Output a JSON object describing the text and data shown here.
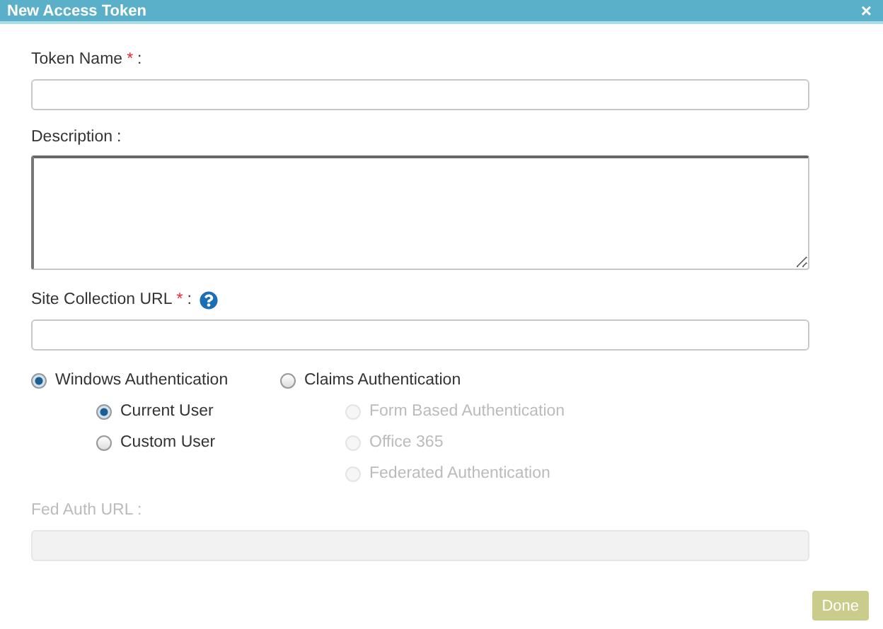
{
  "dialog": {
    "title": "New Access Token",
    "close": "×"
  },
  "fields": [
    {
      "label": "Token Name",
      "required_mark": "*",
      "suffix": ":",
      "kind": "input",
      "help": false
    },
    {
      "label": "Description",
      "suffix": ":",
      "kind": "textarea",
      "help": false
    },
    {
      "label": "Site Collection URL",
      "required_mark": "*",
      "suffix": ":",
      "kind": "input",
      "help": true
    }
  ],
  "auth_options": [
    {
      "label": "Windows Authentication",
      "selected": true,
      "disabled": false,
      "children": [
        {
          "label": "Current User",
          "selected": true,
          "disabled": false
        },
        {
          "label": "Custom User",
          "selected": false,
          "disabled": false
        }
      ]
    },
    {
      "label": "Claims Authentication",
      "selected": false,
      "disabled": false,
      "children": [
        {
          "label": "Form Based Authentication",
          "selected": false,
          "disabled": true
        },
        {
          "label": "Office 365",
          "selected": false,
          "disabled": true
        },
        {
          "label": "Federated Authentication",
          "selected": false,
          "disabled": true
        }
      ]
    }
  ],
  "fed_auth": {
    "label": "Fed Auth URL :",
    "disabled": true
  },
  "buttons": [
    {
      "label": "Done",
      "disabled": true
    }
  ]
}
